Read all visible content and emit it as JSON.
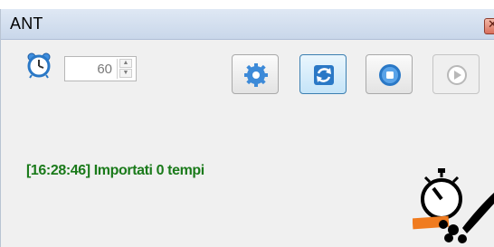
{
  "window": {
    "title": "ANT",
    "close_glyph": "✕"
  },
  "timer": {
    "icon": "alarm-clock-icon",
    "interval_value": "60"
  },
  "toolbar": {
    "buttons": [
      {
        "icon": "gear-icon",
        "state": "enabled"
      },
      {
        "icon": "sync-icon",
        "state": "active"
      },
      {
        "icon": "stop-icon",
        "state": "enabled"
      },
      {
        "icon": "play-icon",
        "state": "disabled"
      }
    ]
  },
  "log": {
    "message": "[16:28:46] Importati 0 tempi",
    "color": "#1a7a1a"
  },
  "logo": {
    "icon": "stopwatch-logo"
  },
  "colors": {
    "accent_blue": "#2a78c6",
    "titlebar": "#c9d7ea"
  }
}
